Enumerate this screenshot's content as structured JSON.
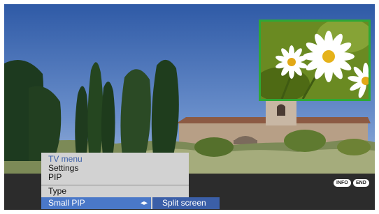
{
  "menu": {
    "header": "TV menu",
    "items": [
      "Settings",
      "PIP"
    ],
    "type_label": "Type",
    "selected_label": "Small PIP",
    "selected_arrows": "◂▸"
  },
  "submenu": {
    "label": "Split screen"
  },
  "buttons": {
    "info": "INFO",
    "end": "END"
  },
  "colors": {
    "menu_bg": "#d2d2d2",
    "selection": "#4a78c8",
    "submenu_bg": "#3b5fa8",
    "pip_border": "#2ea836",
    "bottom_bar": "#2c2c2c"
  },
  "icons": [
    "left-right-arrows-icon"
  ]
}
